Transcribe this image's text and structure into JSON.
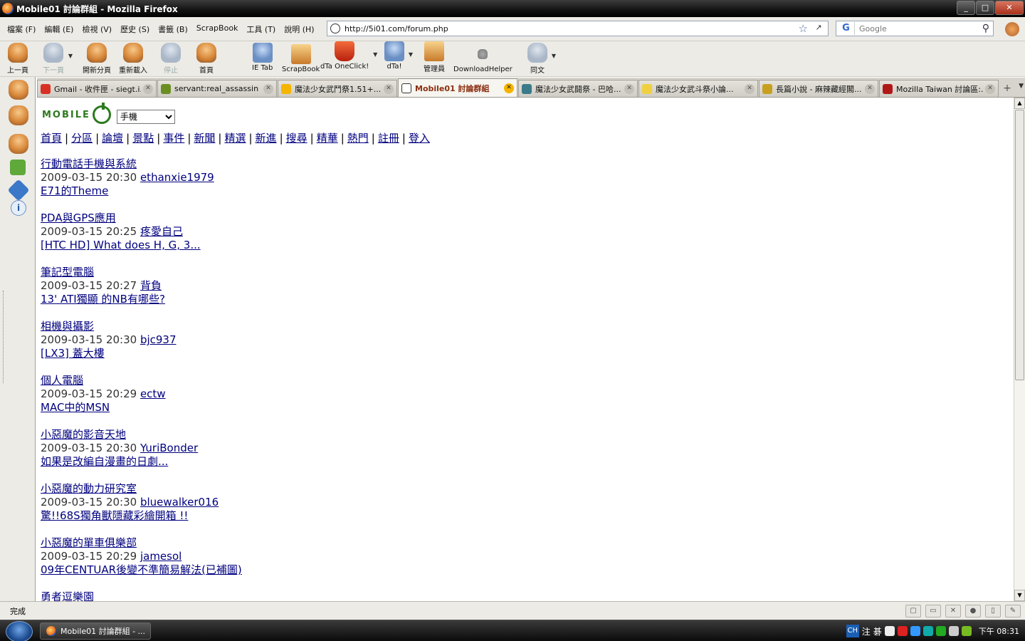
{
  "window": {
    "title": "Mobile01 討論群組 - Mozilla Firefox",
    "buttons": [
      "_",
      "□",
      "✕"
    ]
  },
  "menu": [
    "檔案 (F)",
    "編輯 (E)",
    "檢視 (V)",
    "歷史 (S)",
    "書籤 (B)",
    "ScrapBook",
    "工具 (T)",
    "說明 (H)"
  ],
  "urlbar": {
    "value": "http://5i01.com/forum.php"
  },
  "search": {
    "engine_letter": "G",
    "placeholder": "Google"
  },
  "toolbar": {
    "back": "上一頁",
    "forward": "下一頁",
    "open_tab": "開新分頁",
    "reload": "重新載入",
    "stop": "停止",
    "home": "首頁",
    "ietab": "IE Tab",
    "scrapbook": "ScrapBook",
    "dta_oneclick": "dTa OneClick!",
    "dta": "dTa!",
    "admin": "管理員",
    "downloadhelper": "DownloadHelper",
    "tongwen": "同文"
  },
  "tabs": [
    {
      "label": "Gmail - 收件匣 - siegt.i...",
      "color": "#d93025",
      "active": false
    },
    {
      "label": "servant:real_assassin ...",
      "color": "#6b8e23",
      "active": false
    },
    {
      "label": "魔法少女武鬥祭1.51+...",
      "color": "#f5b400",
      "active": false
    },
    {
      "label": "Mobile01 討論群組",
      "color": "#ffffff",
      "active": true
    },
    {
      "label": "魔法少女武鬪祭 - 巴哈...",
      "color": "#3a7a8a",
      "active": false
    },
    {
      "label": "魔法少女武斗祭小論...",
      "color": "#f0d040",
      "active": false
    },
    {
      "label": "長篇小說 - 麻辣藏經閣...",
      "color": "#c8a020",
      "active": false
    },
    {
      "label": "Mozilla Taiwan 討論區:...",
      "color": "#b01818",
      "active": false
    }
  ],
  "forum": {
    "select_value": "手機",
    "nav": [
      "首頁",
      "分區",
      "論壇",
      "景點",
      "事件",
      "新聞",
      "精選",
      "新進",
      "搜尋",
      "精華",
      "熱門",
      "註冊",
      "登入"
    ],
    "entries": [
      {
        "forum": "行動電話手機與系統",
        "time": "2009-03-15 20:30",
        "user": "ethanxie1979",
        "topic": "E71的Theme"
      },
      {
        "forum": "PDA與GPS應用",
        "time": "2009-03-15 20:25",
        "user": "疼愛自己",
        "topic": "[HTC HD] What does H, G, 3..."
      },
      {
        "forum": "筆記型電腦",
        "time": "2009-03-15 20:27",
        "user": "背負",
        "topic": "13' ATI獨顯 的NB有哪些?"
      },
      {
        "forum": "相機與攝影",
        "time": "2009-03-15 20:30",
        "user": "bjc937",
        "topic": "[LX3] 蓋大樓"
      },
      {
        "forum": "個人電腦",
        "time": "2009-03-15 20:29",
        "user": "ectw",
        "topic": "MAC中的MSN"
      },
      {
        "forum": "小惡魔的影音天地",
        "time": "2009-03-15 20:30",
        "user": "YuriBonder",
        "topic": "如果是改編自漫畫的日劇..."
      },
      {
        "forum": "小惡魔的動力研究室",
        "time": "2009-03-15 20:30",
        "user": "bluewalker016",
        "topic": "驚!!68S獨角獸隱藏彩繪開箱 !!"
      },
      {
        "forum": "小惡魔的單車俱樂部",
        "time": "2009-03-15 20:29",
        "user": "jamesol",
        "topic": "09年CENTUAR後變不準簡易解法(已補圖)"
      },
      {
        "forum": "勇者逗樂園",
        "time": "",
        "user": "",
        "topic": ""
      }
    ]
  },
  "status": {
    "text": "完成"
  },
  "taskbar": {
    "item": "Mobile01 討論群組 - ...",
    "ime": "CH",
    "tray_glyphs": [
      "注",
      "碁"
    ],
    "clock": "下午 08:31"
  }
}
